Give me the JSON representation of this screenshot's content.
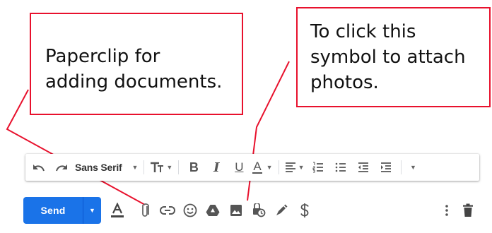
{
  "callouts": {
    "left": {
      "lines": [
        "Paperclip for",
        "adding documents."
      ]
    },
    "right": {
      "lines": [
        "To click this",
        "symbol to attach",
        "photos."
      ]
    },
    "border_color": "#e8112d"
  },
  "toolbar": {
    "undo_icon": "undo-icon",
    "redo_icon": "redo-icon",
    "font_family": "Sans Serif",
    "font_size_icon": "text-size-icon",
    "bold": "B",
    "italic": "I",
    "underline": "U",
    "text_color": "A",
    "align_icon": "align-left-icon",
    "numbered_list_icon": "numbered-list-icon",
    "bulleted_list_icon": "bulleted-list-icon",
    "indent_less_icon": "indent-less-icon",
    "indent_more_icon": "indent-more-icon",
    "more_icon": "chevron-down-icon"
  },
  "compose_actions": {
    "send_label": "Send",
    "send_color": "#1a73e8",
    "icons": [
      "formatting-options-icon",
      "paperclip-icon",
      "link-icon",
      "emoji-icon",
      "google-drive-icon",
      "photo-icon",
      "confidential-mode-icon",
      "signature-icon",
      "dollar-icon",
      "more-options-icon",
      "trash-icon"
    ]
  }
}
